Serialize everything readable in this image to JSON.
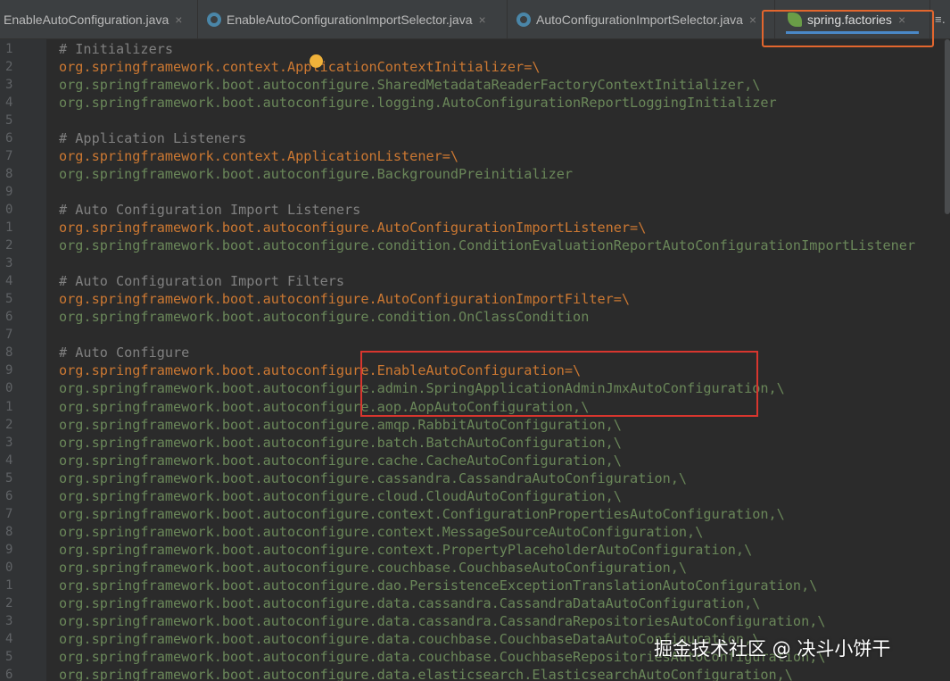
{
  "tabs": [
    {
      "label": "EnableAutoConfiguration.java",
      "active": false
    },
    {
      "label": "EnableAutoConfigurationImportSelector.java",
      "active": false
    },
    {
      "label": "AutoConfigurationImportSelector.java",
      "active": false
    },
    {
      "label": "spring.factories",
      "active": true
    }
  ],
  "tab_overflow": "≡․",
  "colors": {
    "background": "#2b2b2b",
    "keyword_orange": "#cc7832",
    "value_green": "#6a8759",
    "comment_gray": "#808080",
    "tab_highlight_border": "#e2662e",
    "code_highlight_border": "#d8362e"
  },
  "editor": {
    "lines": [
      {
        "num": "1",
        "type": "comment",
        "text": "# Initializers"
      },
      {
        "num": "2",
        "type": "key",
        "text": "org.springframework.context.ApplicationContextInitializer=\\"
      },
      {
        "num": "3",
        "type": "value",
        "text": "org.springframework.boot.autoconfigure.SharedMetadataReaderFactoryContextInitializer,\\"
      },
      {
        "num": "4",
        "type": "value",
        "text": "org.springframework.boot.autoconfigure.logging.AutoConfigurationReportLoggingInitializer"
      },
      {
        "num": "5",
        "type": "blank",
        "text": ""
      },
      {
        "num": "6",
        "type": "comment",
        "text": "# Application Listeners"
      },
      {
        "num": "7",
        "type": "key",
        "text": "org.springframework.context.ApplicationListener=\\"
      },
      {
        "num": "8",
        "type": "value",
        "text": "org.springframework.boot.autoconfigure.BackgroundPreinitializer"
      },
      {
        "num": "9",
        "type": "blank",
        "text": ""
      },
      {
        "num": "0",
        "type": "comment",
        "text": "# Auto Configuration Import Listeners"
      },
      {
        "num": "1",
        "type": "key",
        "text": "org.springframework.boot.autoconfigure.AutoConfigurationImportListener=\\"
      },
      {
        "num": "2",
        "type": "value",
        "text": "org.springframework.boot.autoconfigure.condition.ConditionEvaluationReportAutoConfigurationImportListener"
      },
      {
        "num": "3",
        "type": "blank",
        "text": ""
      },
      {
        "num": "4",
        "type": "comment",
        "text": "# Auto Configuration Import Filters"
      },
      {
        "num": "5",
        "type": "key",
        "text": "org.springframework.boot.autoconfigure.AutoConfigurationImportFilter=\\"
      },
      {
        "num": "6",
        "type": "value",
        "text": "org.springframework.boot.autoconfigure.condition.OnClassCondition"
      },
      {
        "num": "7",
        "type": "blank",
        "text": ""
      },
      {
        "num": "8",
        "type": "comment",
        "text": "# Auto Configure"
      },
      {
        "num": "9",
        "type": "key",
        "text": "org.springframework.boot.autoconfigure.EnableAutoConfiguration=\\"
      },
      {
        "num": "0",
        "type": "value",
        "text": "org.springframework.boot.autoconfigure.admin.SpringApplicationAdminJmxAutoConfiguration,\\"
      },
      {
        "num": "1",
        "type": "value",
        "text": "org.springframework.boot.autoconfigure.aop.AopAutoConfiguration,\\"
      },
      {
        "num": "2",
        "type": "value",
        "text": "org.springframework.boot.autoconfigure.amqp.RabbitAutoConfiguration,\\"
      },
      {
        "num": "3",
        "type": "value",
        "text": "org.springframework.boot.autoconfigure.batch.BatchAutoConfiguration,\\"
      },
      {
        "num": "4",
        "type": "value",
        "text": "org.springframework.boot.autoconfigure.cache.CacheAutoConfiguration,\\"
      },
      {
        "num": "5",
        "type": "value",
        "text": "org.springframework.boot.autoconfigure.cassandra.CassandraAutoConfiguration,\\"
      },
      {
        "num": "6",
        "type": "value",
        "text": "org.springframework.boot.autoconfigure.cloud.CloudAutoConfiguration,\\"
      },
      {
        "num": "7",
        "type": "value",
        "text": "org.springframework.boot.autoconfigure.context.ConfigurationPropertiesAutoConfiguration,\\"
      },
      {
        "num": "8",
        "type": "value",
        "text": "org.springframework.boot.autoconfigure.context.MessageSourceAutoConfiguration,\\"
      },
      {
        "num": "9",
        "type": "value",
        "text": "org.springframework.boot.autoconfigure.context.PropertyPlaceholderAutoConfiguration,\\"
      },
      {
        "num": "0",
        "type": "value",
        "text": "org.springframework.boot.autoconfigure.couchbase.CouchbaseAutoConfiguration,\\"
      },
      {
        "num": "1",
        "type": "value",
        "text": "org.springframework.boot.autoconfigure.dao.PersistenceExceptionTranslationAutoConfiguration,\\"
      },
      {
        "num": "2",
        "type": "value",
        "text": "org.springframework.boot.autoconfigure.data.cassandra.CassandraDataAutoConfiguration,\\"
      },
      {
        "num": "3",
        "type": "value",
        "text": "org.springframework.boot.autoconfigure.data.cassandra.CassandraRepositoriesAutoConfiguration,\\"
      },
      {
        "num": "4",
        "type": "value",
        "text": "org.springframework.boot.autoconfigure.data.couchbase.CouchbaseDataAutoConfiguration,\\"
      },
      {
        "num": "5",
        "type": "value",
        "text": "org.springframework.boot.autoconfigure.data.couchbase.CouchbaseRepositoriesAutoConfiguration,\\"
      },
      {
        "num": "6",
        "type": "value",
        "text": "org.springframework.boot.autoconfigure.data.elasticsearch.ElasticsearchAutoConfiguration,\\"
      }
    ]
  },
  "watermark": "掘金技术社区 @ 决斗小饼干"
}
